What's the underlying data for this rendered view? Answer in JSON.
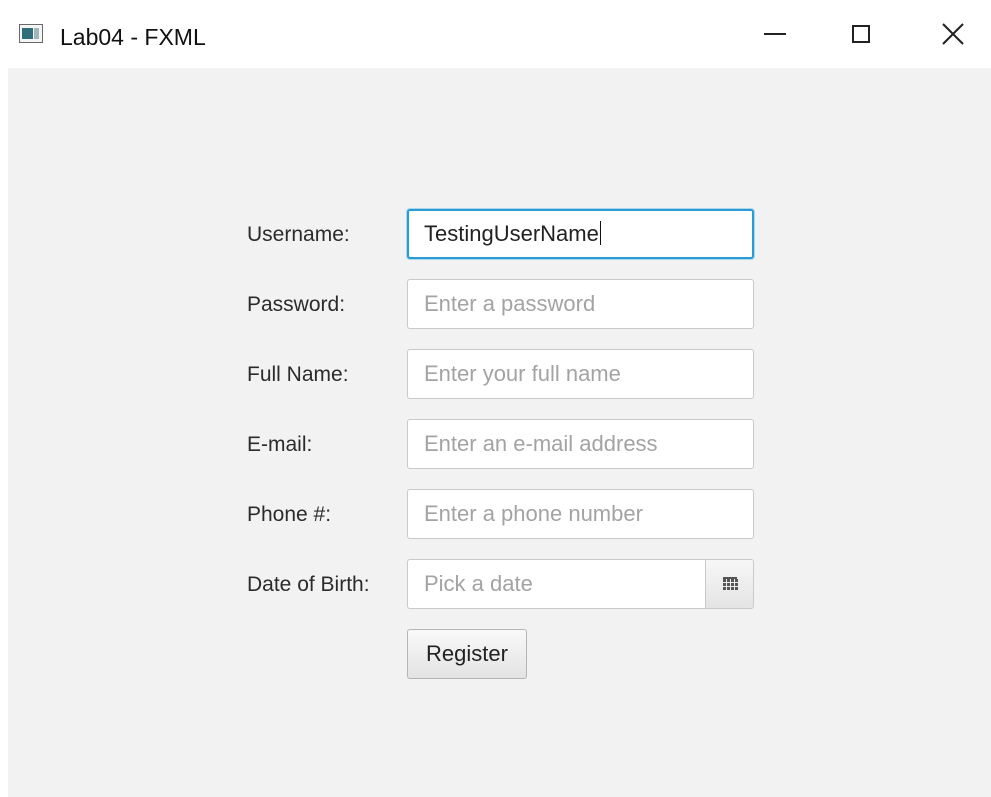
{
  "window": {
    "title": "Lab04 - FXML",
    "icon": "application-window-icon",
    "controls": {
      "minimize": "minimize-icon",
      "maximize": "maximize-icon",
      "close": "close-icon"
    }
  },
  "form": {
    "username": {
      "label": "Username:",
      "value": "TestingUserName",
      "placeholder": ""
    },
    "password": {
      "label": "Password:",
      "value": "",
      "placeholder": "Enter a password"
    },
    "full_name": {
      "label": "Full Name:",
      "value": "",
      "placeholder": "Enter your full name"
    },
    "email": {
      "label": "E-mail:",
      "value": "",
      "placeholder": "Enter an e-mail address"
    },
    "phone": {
      "label": "Phone #:",
      "value": "",
      "placeholder": "Enter a phone number"
    },
    "dob": {
      "label": "Date of Birth:",
      "value": "",
      "placeholder": "Pick a date"
    },
    "register_label": "Register"
  },
  "colors": {
    "focus_border": "#2b9bd4",
    "background": "#f2f2f2",
    "placeholder": "#a3a3a3"
  }
}
